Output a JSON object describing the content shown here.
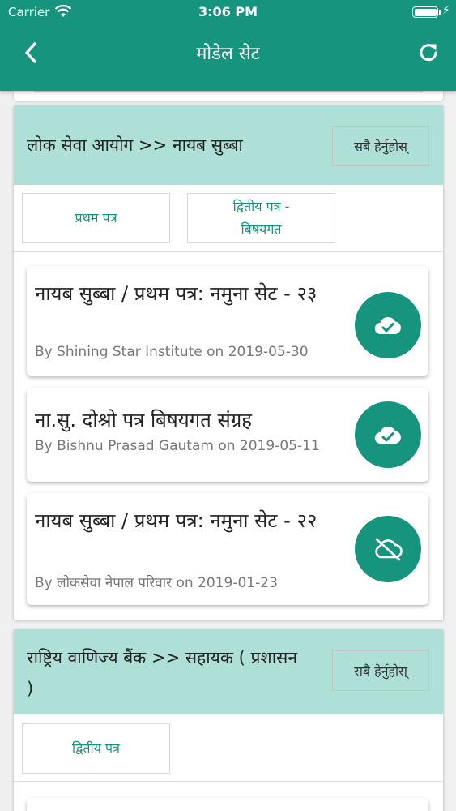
{
  "status_bar": {
    "carrier": "Carrier",
    "time": "3:06 PM"
  },
  "header": {
    "title": "मोडेल सेट"
  },
  "sections": [
    {
      "title": "लोक सेवा आयोग >> नायब सुब्बा",
      "view_all_label": "सबै हेर्नुहोस्",
      "tabs": [
        "प्रथम पत्र",
        "द्वितीय पत्र -\nबिषयगत"
      ],
      "items": [
        {
          "title": "नायब सुब्बा / प्रथम पत्र: नमुना सेट - २३",
          "meta": "By Shining Star Institute on 2019-05-30",
          "icon": "cloud-check-icon"
        },
        {
          "title": "ना.सु. दोश्रो पत्र बिषयगत संग्रह",
          "meta": "By Bishnu Prasad Gautam on 2019-05-11",
          "icon": "cloud-check-icon"
        },
        {
          "title": "नायब सुब्बा / प्रथम पत्र: नमुना सेट - २२",
          "meta": "By लोकसेवा नेपाल परिवार on 2019-01-23",
          "icon": "cloud-off-icon"
        }
      ]
    },
    {
      "title": "राष्ट्रिय वाणिज्य बैंक >> सहायक ( प्रशासन )",
      "view_all_label": "सबै हेर्नुहोस्",
      "tabs": [
        "द्वितीय पत्र"
      ]
    }
  ],
  "colors": {
    "primary": "#16947e",
    "section_header": "#aee0d7"
  }
}
